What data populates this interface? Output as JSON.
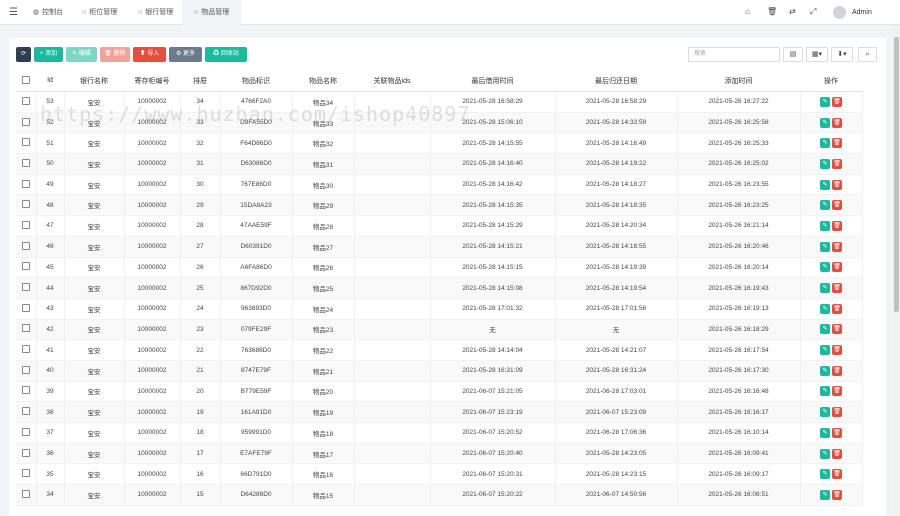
{
  "nav": {
    "tabs": [
      {
        "label": "控制台"
      },
      {
        "label": "柜位管理"
      },
      {
        "label": "银行管理"
      },
      {
        "label": "物品管理"
      }
    ]
  },
  "user": {
    "name": "Admin"
  },
  "toolbar": {
    "refresh": "⟳",
    "add": "+ 添加",
    "edit": "✎ 编辑",
    "delete": "🗑 删除",
    "import": "⬆ 导入",
    "more": "⚙ 更多",
    "recycle": "♻ 回收站"
  },
  "search": {
    "placeholder": "搜索"
  },
  "watermark": "https://www.huzhan.com/ishop40897",
  "table": {
    "headers": [
      "Id",
      "银行名称",
      "寄存柜编号",
      "排屉",
      "物品标识",
      "物品名称",
      "关联物品ids",
      "最后借用时间",
      "最后归还日期",
      "添加时间",
      "操作"
    ],
    "rows": [
      [
        "53",
        "宝安",
        "10000002",
        "34",
        "4766F2A0",
        "物品34",
        "",
        "2021-05-28 16:58:29",
        "2021-05-28 16:58:29",
        "2021-05-26 16:27:22"
      ],
      [
        "52",
        "宝安",
        "10000002",
        "33",
        "D9FA55D0",
        "物品33",
        "",
        "2021-05-28 15:06:10",
        "2021-05-28 14:33:59",
        "2021-05-26 16:25:58"
      ],
      [
        "51",
        "宝安",
        "10000002",
        "32",
        "F64D86D0",
        "物品32",
        "",
        "2021-05-28 14:15:55",
        "2021-05-28 14:16:49",
        "2021-05-26 16:25:33"
      ],
      [
        "50",
        "宝安",
        "10000002",
        "31",
        "D63086D0",
        "物品31",
        "",
        "2021-05-28 14:16:40",
        "2021-05-28 14:19:22",
        "2021-05-26 16:25:02"
      ],
      [
        "49",
        "宝安",
        "10000002",
        "30",
        "767E86D0",
        "物品30",
        "",
        "2021-05-28 14:16:42",
        "2021-05-28 14:18:27",
        "2021-05-26 16:23:55"
      ],
      [
        "48",
        "宝安",
        "10000002",
        "29",
        "15DA8A23",
        "物品29",
        "",
        "2021-05-28 14:15:35",
        "2021-05-28 14:18:35",
        "2021-05-26 16:23:25"
      ],
      [
        "47",
        "宝安",
        "10000002",
        "28",
        "47AAE59F",
        "物品28",
        "",
        "2021-05-28 14:15:29",
        "2021-05-28 14:20:34",
        "2021-05-26 16:21:14"
      ],
      [
        "46",
        "宝安",
        "10000002",
        "27",
        "D60391D0",
        "物品27",
        "",
        "2021-05-28 14:15:21",
        "2021-05-28 14:18:55",
        "2021-05-26 16:20:46"
      ],
      [
        "45",
        "宝安",
        "10000002",
        "26",
        "A6FA86D0",
        "物品26",
        "",
        "2021-05-28 14:15:15",
        "2021-05-28 14:19:39",
        "2021-05-26 16:20:14"
      ],
      [
        "44",
        "宝安",
        "10000002",
        "25",
        "867D92D0",
        "物品25",
        "",
        "2021-05-28 14:15:08",
        "2021-05-28 14:19:54",
        "2021-05-26 16:19:43"
      ],
      [
        "43",
        "宝安",
        "10000002",
        "24",
        "963893D0",
        "物品24",
        "",
        "2021-05-28 17:01:32",
        "2021-05-28 17:01:56",
        "2021-05-26 16:19:13"
      ],
      [
        "42",
        "宝安",
        "10000002",
        "23",
        "079FE29F",
        "物品23",
        "",
        "无",
        "无",
        "2021-05-26 16:18:29"
      ],
      [
        "41",
        "宝安",
        "10000002",
        "22",
        "763686D0",
        "物品22",
        "",
        "2021-05-28 14:14:04",
        "2021-05-28 14:21:07",
        "2021-05-26 16:17:54"
      ],
      [
        "40",
        "宝安",
        "10000002",
        "21",
        "8747E79F",
        "物品21",
        "",
        "2021-05-28 16:31:09",
        "2021-05-28 16:31:24",
        "2021-05-26 16:17:30"
      ],
      [
        "39",
        "宝安",
        "10000002",
        "20",
        "B779E59F",
        "物品20",
        "",
        "2021-06-07 15:21:05",
        "2021-06-28 17:03:01",
        "2021-05-26 16:16:48"
      ],
      [
        "38",
        "宝安",
        "10000002",
        "19",
        "161A91D0",
        "物品19",
        "",
        "2021-06-07 15:23:19",
        "2021-06-07 15:23:09",
        "2021-05-26 16:16:17"
      ],
      [
        "37",
        "宝安",
        "10000002",
        "18",
        "959991D0",
        "物品18",
        "",
        "2021-06-07 15:20:52",
        "2021-06-28 17:06:36",
        "2021-05-26 16:10:14"
      ],
      [
        "36",
        "宝安",
        "10000002",
        "17",
        "E7AFE79F",
        "物品17",
        "",
        "2021-06-07 15:20:40",
        "2021-05-28 14:23:05",
        "2021-05-26 16:09:41"
      ],
      [
        "35",
        "宝安",
        "10000002",
        "16",
        "66D791D0",
        "物品16",
        "",
        "2021-06-07 15:20:31",
        "2021-05-28 14:23:15",
        "2021-05-26 16:09:17"
      ],
      [
        "34",
        "宝安",
        "10000002",
        "15",
        "D64286D0",
        "物品15",
        "",
        "2021-06-07 15:20:22",
        "2021-06-07 14:50:56",
        "2021-05-26 16:08:51"
      ]
    ]
  }
}
